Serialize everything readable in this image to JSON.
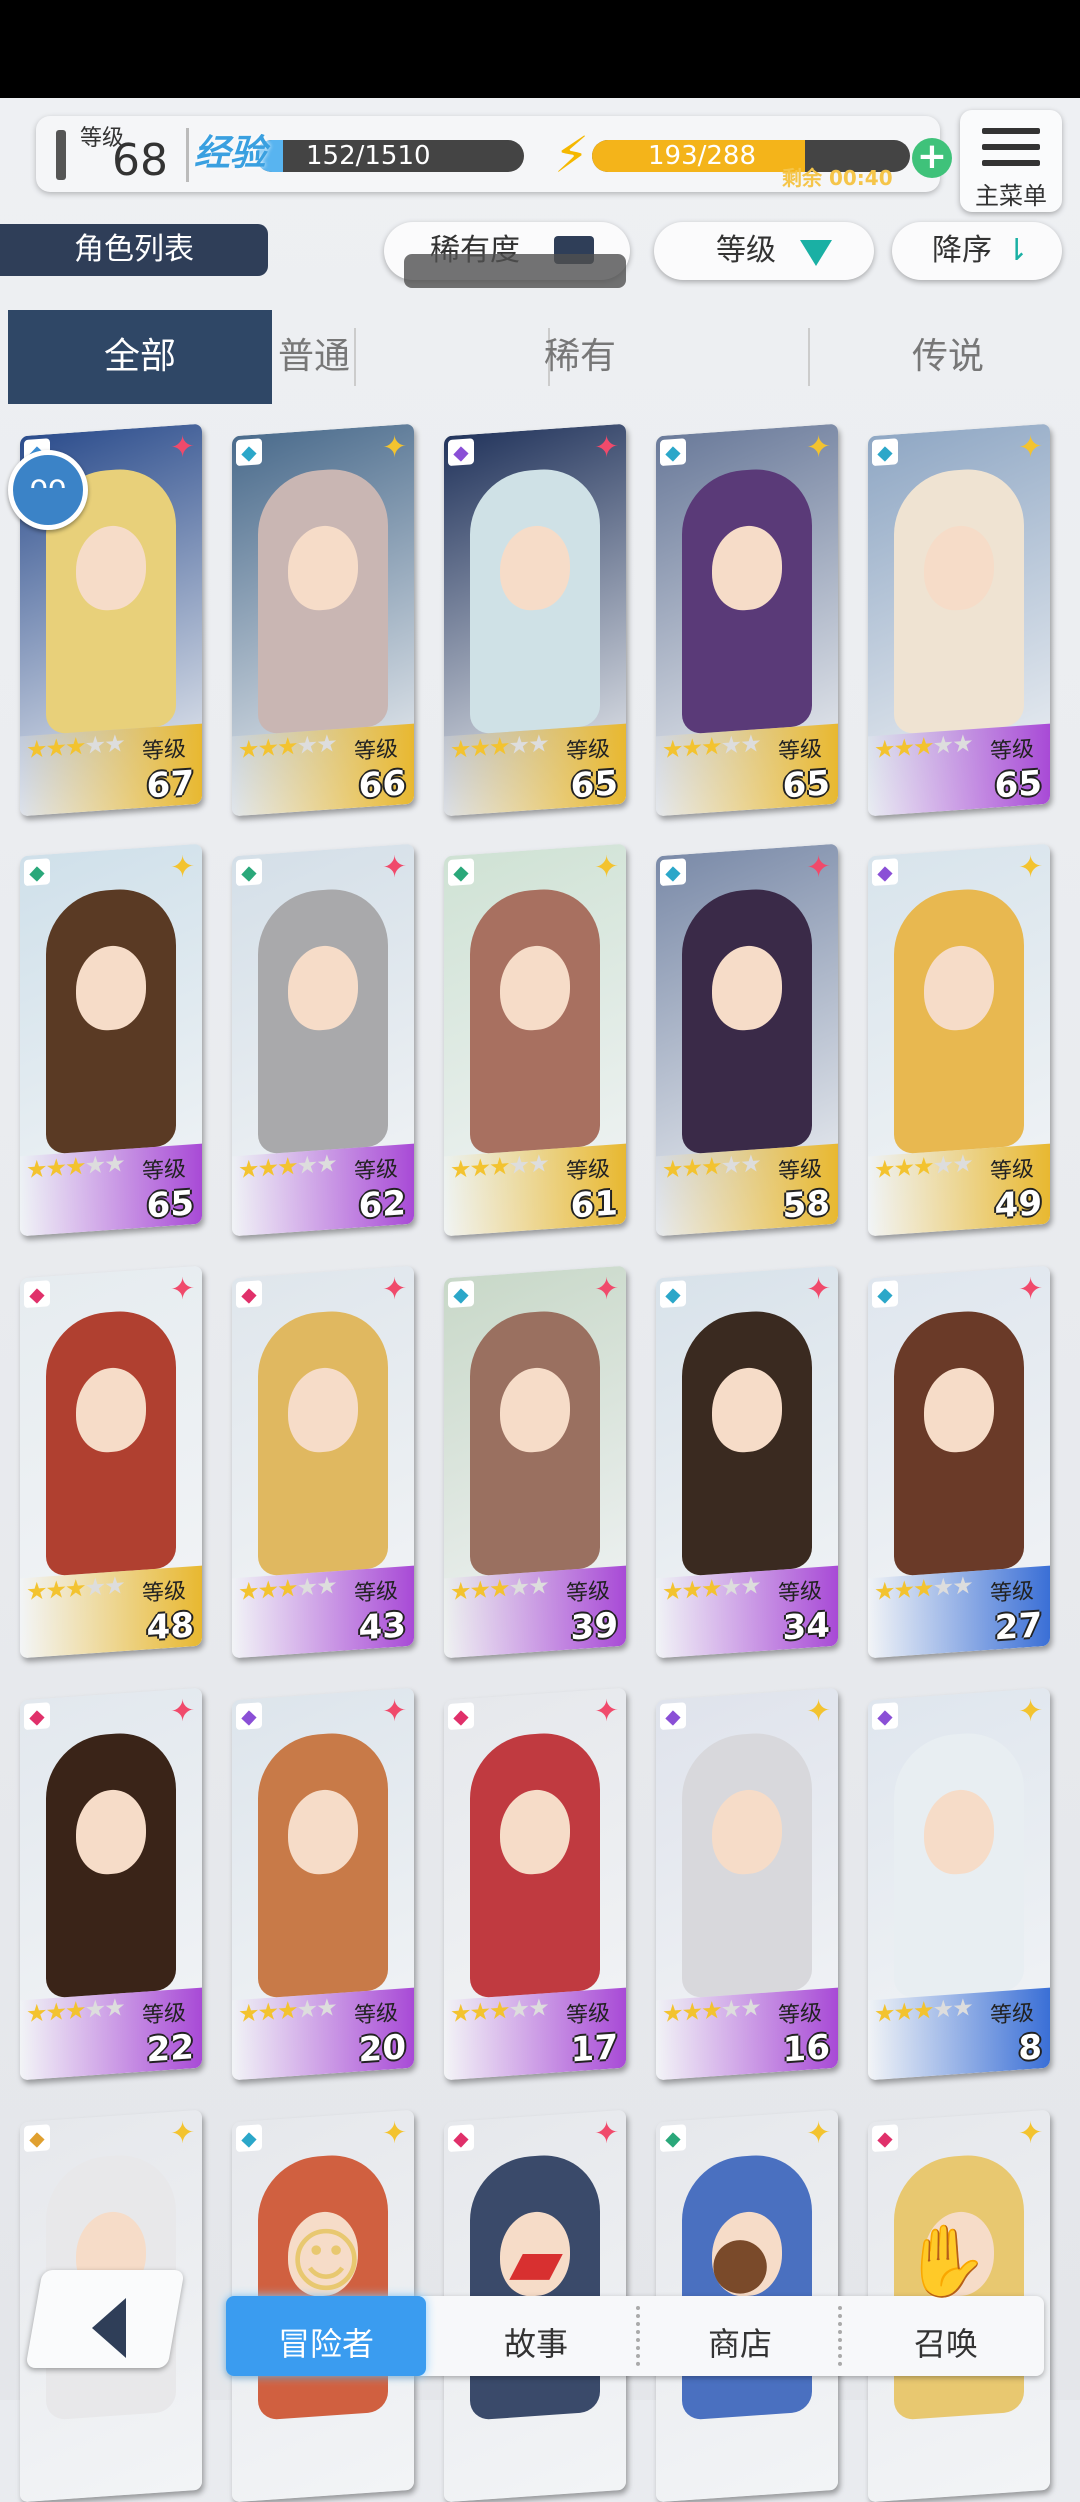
{
  "header": {
    "level_label": "等级",
    "level": "68",
    "exp_label": "经验",
    "exp_text": "152/1510",
    "exp_ratio": 0.1,
    "stamina_text": "193/288",
    "stamina_ratio": 0.67,
    "remaining_label": "剩余",
    "remaining_time": "00:40",
    "menu_label": "主菜单"
  },
  "filters": {
    "role_list": "角色列表",
    "rarity": "稀有度",
    "level": "等级",
    "order": "降序"
  },
  "tabs": [
    "全部",
    "普通",
    "稀有",
    "传说"
  ],
  "card_level_label": "等级",
  "cards": [
    {
      "level": "67",
      "stars": 3,
      "rarity_color": "#f04a6b",
      "elem": "#3b8fd6",
      "hair": "#e8d07a",
      "bg": "#2b4c8c",
      "band": "#e8b830"
    },
    {
      "level": "66",
      "stars": 3,
      "rarity_color": "#f3c32f",
      "elem": "#2ba7c9",
      "hair": "#c9b6b3",
      "bg": "#4a6b8c",
      "band": "#e8b830"
    },
    {
      "level": "65",
      "stars": 3,
      "rarity_color": "#f04a6b",
      "elem": "#8a4fd6",
      "hair": "#cfe1e6",
      "bg": "#22345c",
      "band": "#e8b830"
    },
    {
      "level": "65",
      "stars": 3,
      "rarity_color": "#f3c32f",
      "elem": "#2ba7c9",
      "hair": "#5a3a78",
      "bg": "#6a7a9a",
      "band": "#e8b830"
    },
    {
      "level": "65",
      "stars": 3,
      "rarity_color": "#f3c32f",
      "elem": "#2ba7c9",
      "hair": "#efe3d2",
      "bg": "#8fa7c4",
      "band": "#a84ad6"
    },
    {
      "level": "65",
      "stars": 3,
      "rarity_color": "#f3c32f",
      "elem": "#2aa87a",
      "hair": "#5a3a24",
      "bg": "#cfe0ea",
      "band": "#a84ad6"
    },
    {
      "level": "62",
      "stars": 3,
      "rarity_color": "#f04a6b",
      "elem": "#2aa87a",
      "hair": "#a9a9ab",
      "bg": "#d4dfe8",
      "band": "#a84ad6"
    },
    {
      "level": "61",
      "stars": 3,
      "rarity_color": "#f3c32f",
      "elem": "#2aa87a",
      "hair": "#a87060",
      "bg": "#cfe2d4",
      "band": "#e8b830"
    },
    {
      "level": "58",
      "stars": 3,
      "rarity_color": "#f04a6b",
      "elem": "#2ba7c9",
      "hair": "#3a2a48",
      "bg": "#7a8aa8",
      "band": "#e8b830"
    },
    {
      "level": "49",
      "stars": 3,
      "rarity_color": "#f3c32f",
      "elem": "#8a4fd6",
      "hair": "#e8b850",
      "bg": "#d8e4ec",
      "band": "#e8b830"
    },
    {
      "level": "48",
      "stars": 3,
      "rarity_color": "#f04a6b",
      "elem": "#e0306a",
      "hair": "#b04030",
      "bg": "#e6ecf0",
      "band": "#e8b830"
    },
    {
      "level": "43",
      "stars": 3,
      "rarity_color": "#f04a6b",
      "elem": "#e0306a",
      "hair": "#e0b860",
      "bg": "#dfe6ec",
      "band": "#a84ad6"
    },
    {
      "level": "39",
      "stars": 3,
      "rarity_color": "#f04a6b",
      "elem": "#2ba7c9",
      "hair": "#9a7060",
      "bg": "#c8d8c8",
      "band": "#a84ad6"
    },
    {
      "level": "34",
      "stars": 3,
      "rarity_color": "#f04a6b",
      "elem": "#2ba7c9",
      "hair": "#3a2a20",
      "bg": "#d8e2ea",
      "band": "#a84ad6"
    },
    {
      "level": "27",
      "stars": 3,
      "rarity_color": "#f04a6b",
      "elem": "#2ba7c9",
      "hair": "#6a3a28",
      "bg": "#dfe6ee",
      "band": "#3a6fd6"
    },
    {
      "level": "22",
      "stars": 3,
      "rarity_color": "#f04a6b",
      "elem": "#e0306a",
      "hair": "#3a2418",
      "bg": "#e2e8ee",
      "band": "#a84ad6"
    },
    {
      "level": "20",
      "stars": 3,
      "rarity_color": "#f04a6b",
      "elem": "#8a4fd6",
      "hair": "#c87a48",
      "bg": "#dde5ec",
      "band": "#a84ad6"
    },
    {
      "level": "17",
      "stars": 3,
      "rarity_color": "#f04a6b",
      "elem": "#e0306a",
      "hair": "#c03a40",
      "bg": "#e6e8ec",
      "band": "#a84ad6"
    },
    {
      "level": "16",
      "stars": 3,
      "rarity_color": "#f3c32f",
      "elem": "#8a4fd6",
      "hair": "#d8d8dc",
      "bg": "#dfe3ec",
      "band": "#a84ad6"
    },
    {
      "level": "8",
      "stars": 3,
      "rarity_color": "#f3c32f",
      "elem": "#8a4fd6",
      "hair": "#e8eef2",
      "bg": "#dfe6ee",
      "band": "#3a6fd6"
    },
    {
      "level": "",
      "stars": 0,
      "rarity_color": "#f3c32f",
      "elem": "#e0a030",
      "hair": "#e8e8ea",
      "bg": "#e6e8ec",
      "band": "#e6e8ec"
    },
    {
      "level": "",
      "stars": 0,
      "rarity_color": "#f3c32f",
      "elem": "#2ba7c9",
      "hair": "#d06040",
      "bg": "#e6e8ec",
      "band": "#e6e8ec"
    },
    {
      "level": "",
      "stars": 0,
      "rarity_color": "#f04a6b",
      "elem": "#e0306a",
      "hair": "#3a4a6a",
      "bg": "#e6e8ec",
      "band": "#e6e8ec"
    },
    {
      "level": "",
      "stars": 0,
      "rarity_color": "#f3c32f",
      "elem": "#2aa87a",
      "hair": "#4a70c0",
      "bg": "#e6e8ec",
      "band": "#e6e8ec"
    },
    {
      "level": "",
      "stars": 0,
      "rarity_color": "#f3c32f",
      "elem": "#e0306a",
      "hair": "#e8c870",
      "bg": "#e6e8ec",
      "band": "#e6e8ec"
    }
  ],
  "nav": {
    "adventurer": "冒险者",
    "story": "故事",
    "shop": "商店",
    "summon": "召唤"
  }
}
